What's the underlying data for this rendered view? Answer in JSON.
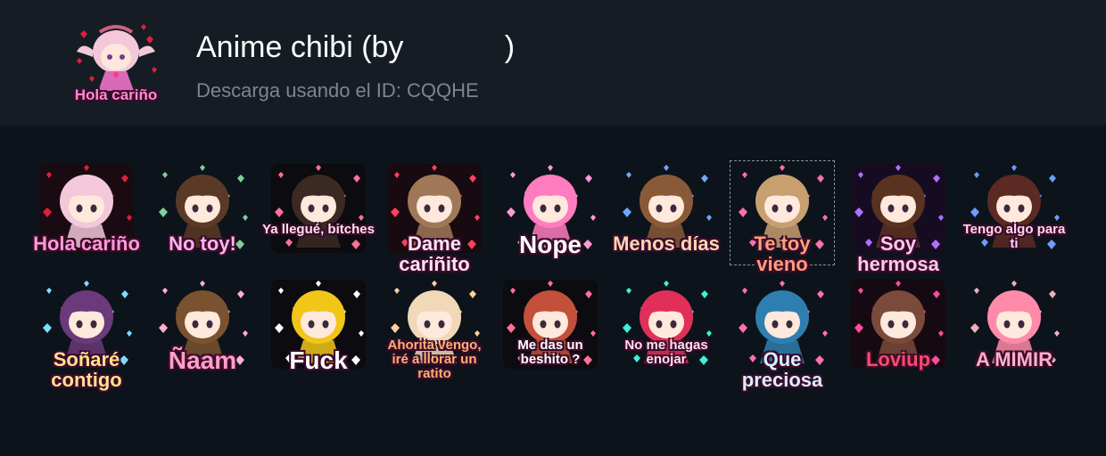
{
  "pack": {
    "title": "Anime chibi (by            )",
    "subtitle": "Descarga usando el ID: CQQHE",
    "thumb_label": "Hola cariño"
  },
  "stickers": [
    {
      "label": "Hola cariño",
      "color": "#ff9ad8",
      "hair": "#f3c8d9",
      "bg": "#1a0b12",
      "hearts": "#e0203a"
    },
    {
      "label": "No toy!",
      "color": "#ffb3f0",
      "hair": "#5a3a26",
      "bg": "#0d131a",
      "hearts": "#7fcf9a"
    },
    {
      "label": "Ya llegué, bitches",
      "color": "#ffe0ee",
      "hair": "#3b2a22",
      "bg": "#0b0b10",
      "hearts": "#ff6f9a"
    },
    {
      "label": "Dame cariñito",
      "color": "#ffe3f3",
      "hair": "#a07858",
      "bg": "#170a10",
      "hearts": "#ff4060"
    },
    {
      "label": "Nope",
      "color": "#ffffff",
      "hair": "#ff7cc0",
      "bg": "#0d131a",
      "hearts": "#ff9ad8"
    },
    {
      "label": "Menos días",
      "color": "#ffd7b4",
      "hair": "#8a5a38",
      "bg": "#0d131a",
      "hearts": "#6fa8ff"
    },
    {
      "label": "Te toy vieno",
      "color": "#ff9f7a",
      "hair": "#c8a070",
      "bg": "#0d131a",
      "hearts": "#ff6fb0"
    },
    {
      "label": "Soy hermosa",
      "color": "#ffc9ec",
      "hair": "#5a3220",
      "bg": "#160c22",
      "hearts": "#b070ff"
    },
    {
      "label": "Tengo algo para ti",
      "color": "#ffd7ee",
      "hair": "#5c2a22",
      "bg": "#0d131a",
      "hearts": "#6f9cff"
    },
    {
      "label": "Soñaré contigo",
      "color": "#ffe28a",
      "hair": "#6a3a7a",
      "bg": "#0d131a",
      "hearts": "#7fdcff"
    },
    {
      "label": "Ñaam",
      "color": "#ff9fc8",
      "hair": "#7a5230",
      "bg": "#0d131a",
      "hearts": "#ffb0d0"
    },
    {
      "label": "Fuck",
      "color": "#ffffff",
      "hair": "#f2c519",
      "bg": "#0b0b10",
      "hearts": "#ffffff"
    },
    {
      "label": "Ahorita vengo, iré a llorar un ratito",
      "color": "#ffb070",
      "hair": "#f0d8b8",
      "bg": "#0d131a",
      "hearts": "#ffd0a0"
    },
    {
      "label": "Me das un beshito ?",
      "color": "#ffffff",
      "hair": "#c2503a",
      "bg": "#0b0b10",
      "hearts": "#ff6f9a"
    },
    {
      "label": "No me hagas enojar",
      "color": "#ffe0f0",
      "hair": "#e0305a",
      "bg": "#0d131a",
      "hearts": "#40f0d8"
    },
    {
      "label": "Que preciosa",
      "color": "#d8f0ff",
      "hair": "#2e7fb0",
      "bg": "#0d131a",
      "hearts": "#ff6fb0"
    },
    {
      "label": "Loviup",
      "color": "#ff4a6a",
      "hair": "#7a4a3a",
      "bg": "#160a12",
      "hearts": "#ff4aa0"
    },
    {
      "label": "A MIMIR",
      "color": "#ffb0c8",
      "hair": "#ff8aaa",
      "bg": "#0d131a",
      "hearts": "#f0b0c0"
    }
  ]
}
